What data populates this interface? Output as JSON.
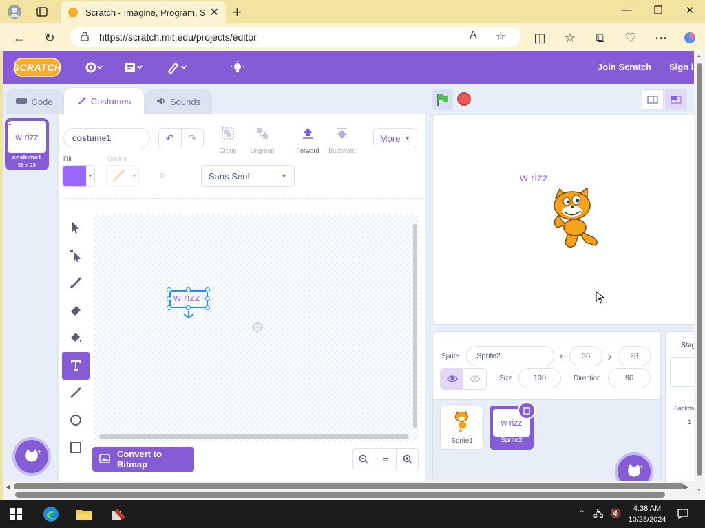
{
  "browser": {
    "tab_title": "Scratch - Imagine, Program, Share",
    "url": "https://scratch.mit.edu/projects/editor"
  },
  "menubar": {
    "logo": "SCRATCH",
    "join": "Join Scratch",
    "signin": "Sign in"
  },
  "editor_tabs": [
    {
      "label": "Code"
    },
    {
      "label": "Costumes"
    },
    {
      "label": "Sounds"
    }
  ],
  "costume_list": [
    {
      "number": "1",
      "thumb_text": "w rizz",
      "name": "costume1",
      "size": "58 x 28"
    }
  ],
  "paint": {
    "costume_name": "costume1",
    "tools_top": [
      {
        "label": "Group"
      },
      {
        "label": "Ungroup"
      },
      {
        "label": "Forward"
      },
      {
        "label": "Backward"
      }
    ],
    "more_label": "More",
    "fill_label": "Fill",
    "outline_label": "Outline",
    "outline_width": "0",
    "font": "Sans Serif",
    "canvas_text": "w rizz",
    "convert_label": "Convert to Bitmap",
    "zoom_reset": "="
  },
  "stage": {
    "text": "w rizz"
  },
  "sprite_info": {
    "sprite_label": "Sprite",
    "sprite_name": "Sprite2",
    "x_label": "x",
    "x_value": "36",
    "y_label": "y",
    "y_value": "28",
    "size_label": "Size",
    "size_value": "100",
    "direction_label": "Direction",
    "direction_value": "90"
  },
  "sprites": [
    {
      "name": "Sprite1",
      "thumb_text": ""
    },
    {
      "name": "Sprite2",
      "thumb_text": "w rizz"
    }
  ],
  "stage_pane": {
    "label": "Stage",
    "backdrops_label": "Backdrops",
    "backdrops_count": "1"
  },
  "taskbar": {
    "time": "4:38 AM",
    "date": "10/28/2024"
  },
  "colors": {
    "scratch_purple": "#855cd6",
    "fill_color": "#9966ff",
    "browser_frame": "#f3e3a0"
  }
}
